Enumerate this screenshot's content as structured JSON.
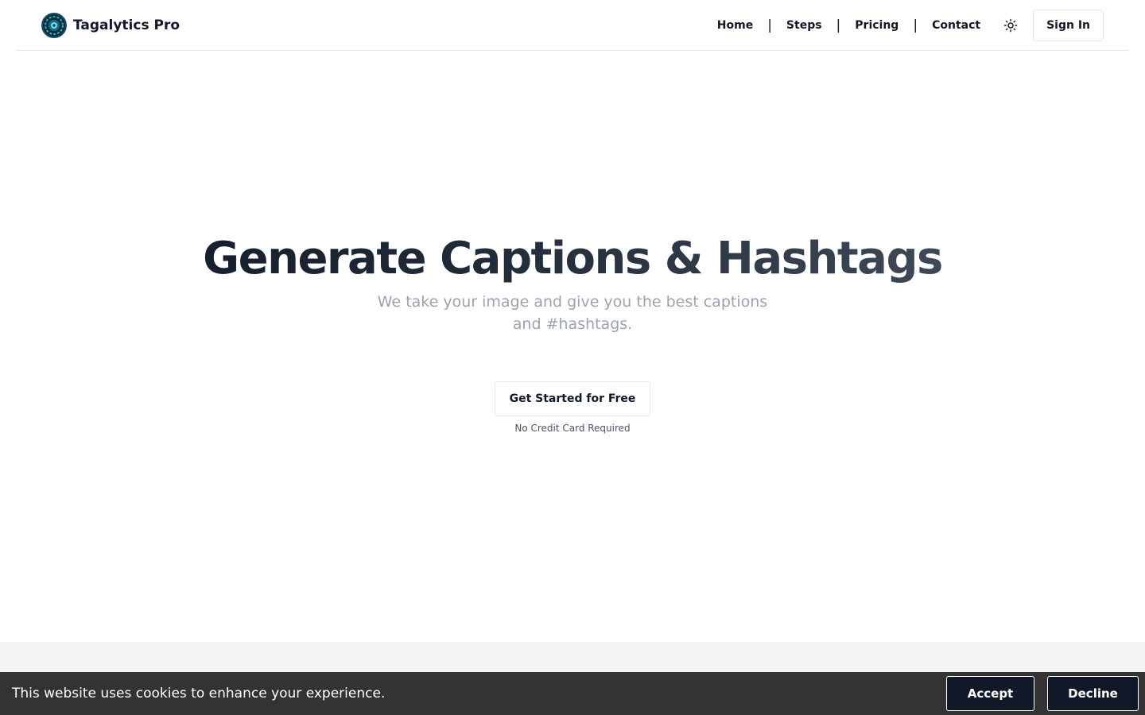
{
  "header": {
    "brand_name": "Tagalytics Pro",
    "logo_icon": "brand-logo-icon",
    "nav": [
      {
        "label": "Home"
      },
      {
        "label": "Steps"
      },
      {
        "label": "Pricing"
      },
      {
        "label": "Contact"
      }
    ],
    "separator": "|",
    "theme_icon": "sun-icon",
    "signin_label": "Sign In"
  },
  "hero": {
    "title": "Generate Captions & Hashtags",
    "subtitle": "We take your image and give you the best captions and #hashtags.",
    "cta_label": "Get Started for Free",
    "cta_note": "No Credit Card Required"
  },
  "cookie": {
    "message": "This website uses cookies to enhance your experience.",
    "accept_label": "Accept",
    "decline_label": "Decline"
  },
  "colors": {
    "text": "#111827",
    "muted": "#9ca3af",
    "cookie_bg": "#333333",
    "cookie_btn_bg": "#111827",
    "band": "#f3f4f6"
  }
}
